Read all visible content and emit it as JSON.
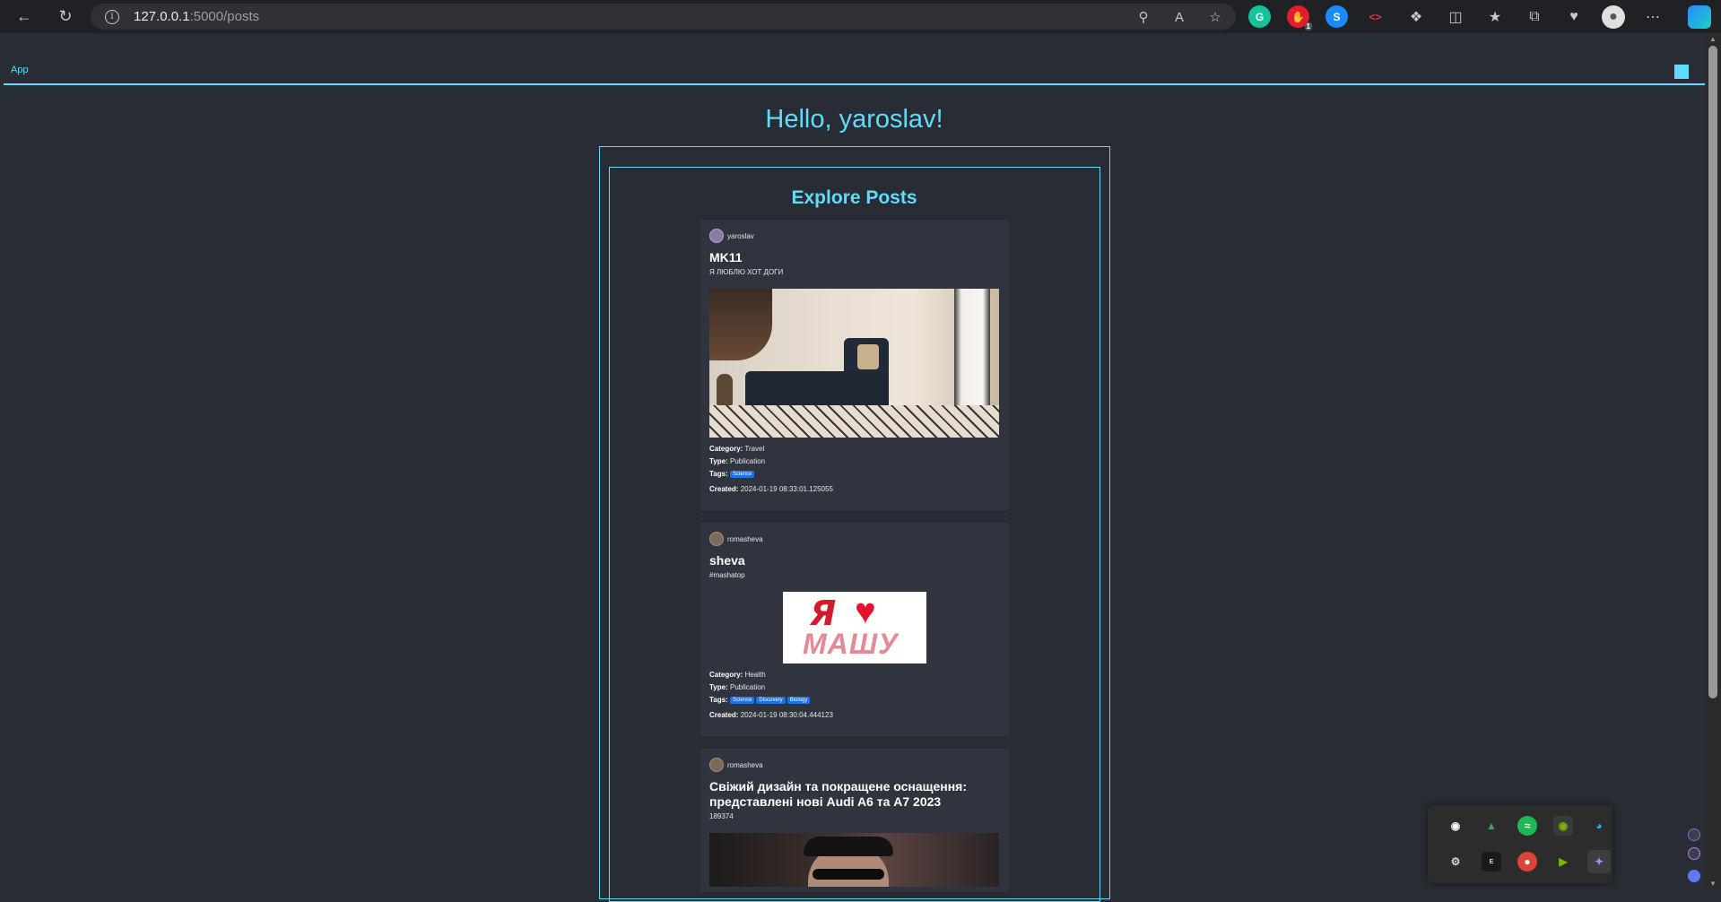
{
  "browser": {
    "url_host": "127.0.0.1",
    "url_path": ":5000/posts",
    "extension_badge": "1"
  },
  "app": {
    "brand": "App"
  },
  "page": {
    "greeting": "Hello, yaroslav!",
    "section_title": "Explore Posts"
  },
  "labels": {
    "category": "Category:",
    "type": "Type:",
    "tags": "Tags:",
    "created": "Created:"
  },
  "posts": [
    {
      "author": "yaroslav",
      "title": "MK11",
      "text": "Я ЛЮБЛЮ ХОТ ДОГИ",
      "category": "Travel",
      "type": "Publication",
      "tags": [
        "Science"
      ],
      "created": "2024-01-19 08:33:01.125055"
    },
    {
      "author": "romasheva",
      "title": "sheva",
      "text": "#mashatop",
      "image_text_1": "Я",
      "image_text_2": "МАШУ",
      "category": "Health",
      "type": "Publication",
      "tags": [
        "Science",
        "Discovery",
        "Biology"
      ],
      "created": "2024-01-19 08:30:04.444123"
    },
    {
      "author": "romasheva",
      "title": "Свіжий дизайн та покращене оснащення: представлені нові Audi A6 та A7 2023",
      "text": "189374"
    }
  ],
  "colors": {
    "accent": "#61dafb",
    "background": "#282c34",
    "card": "#30343e",
    "tag": "#1a73e8"
  }
}
